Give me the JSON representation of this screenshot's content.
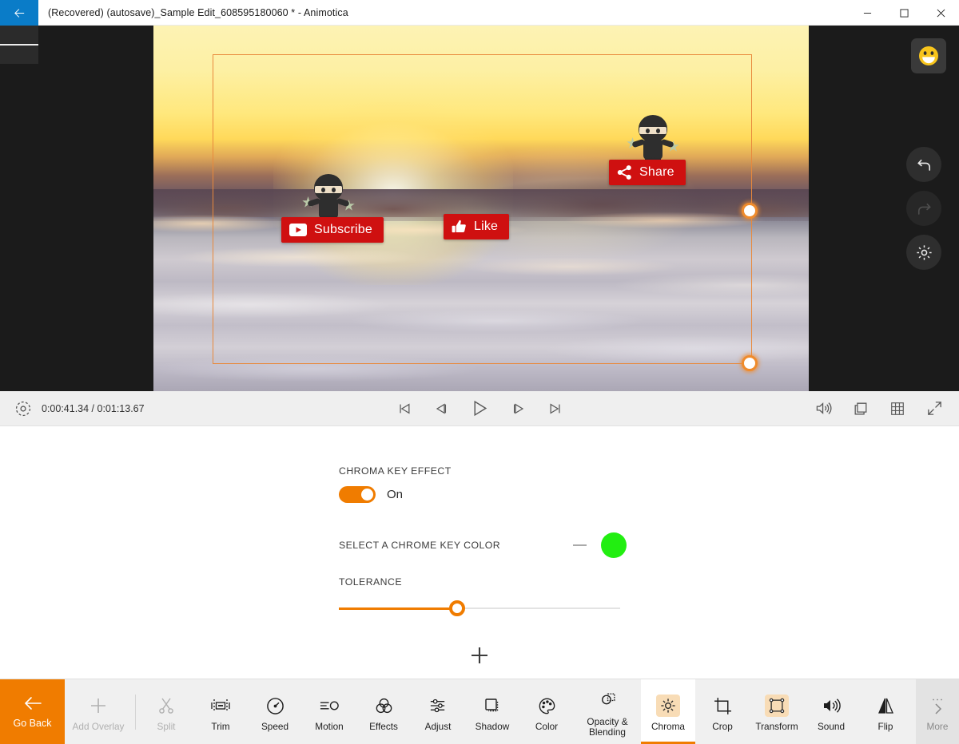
{
  "window": {
    "title": "(Recovered) (autosave)_Sample Edit_608595180060 * - Animotica",
    "back_icon": "arrow-left-icon",
    "minimize_label": "Minimize",
    "maximize_label": "Maximize",
    "close_label": "Close"
  },
  "stage": {
    "menu_icon": "hamburger-menu-icon",
    "right_rail": [
      {
        "name": "emoji-button",
        "icon": "smiley-face-icon",
        "state": "active"
      },
      {
        "name": "undo-button",
        "icon": "undo-arrow-icon",
        "state": "enabled"
      },
      {
        "name": "redo-button",
        "icon": "redo-arrow-icon",
        "state": "disabled"
      },
      {
        "name": "settings-button",
        "icon": "gear-icon",
        "state": "enabled"
      }
    ],
    "overlays": [
      {
        "label": "Subscribe",
        "icon": "youtube-play-icon",
        "color": "#cf1010"
      },
      {
        "label": "Like",
        "icon": "thumbs-up-icon",
        "color": "#cf1010"
      },
      {
        "label": "Share",
        "icon": "share-nodes-icon",
        "color": "#cf1010"
      }
    ],
    "selection_frame_color": "#e8893c"
  },
  "transport": {
    "settings_icon": "target-settings-icon",
    "timecode": "0:00:41.34 / 0:01:13.67",
    "current_time": "0:00:41.34",
    "total_time": "0:01:13.67",
    "controls": [
      {
        "name": "skip-to-start-button",
        "icon": "skip-start-icon"
      },
      {
        "name": "step-back-button",
        "icon": "step-back-icon"
      },
      {
        "name": "play-button",
        "icon": "play-icon"
      },
      {
        "name": "step-forward-button",
        "icon": "step-forward-icon"
      },
      {
        "name": "skip-to-end-button",
        "icon": "skip-end-icon"
      }
    ],
    "right_controls": [
      {
        "name": "volume-button",
        "icon": "speaker-volume-icon"
      },
      {
        "name": "duplicate-button",
        "icon": "copy-layers-icon"
      },
      {
        "name": "grid-button",
        "icon": "grid-icon"
      },
      {
        "name": "fullscreen-button",
        "icon": "expand-diagonal-icon"
      }
    ]
  },
  "panel": {
    "effect_label": "CHROMA KEY EFFECT",
    "toggle_state": "On",
    "toggle_on": true,
    "color_label": "SELECT A CHROME KEY COLOR",
    "selected_color": "#22ee11",
    "minus_icon": "minus-icon",
    "tolerance_label": "TOLERANCE",
    "tolerance_percent": 42,
    "add_icon": "plus-icon"
  },
  "toolbar": {
    "go_back": {
      "label": "Go Back",
      "icon": "arrow-left-icon"
    },
    "items": [
      {
        "label": "Add Overlay",
        "icon": "plus-icon",
        "disabled": true,
        "active": false,
        "icon_highlight": false
      },
      {
        "label": "Split",
        "icon": "scissors-icon",
        "disabled": true,
        "active": false,
        "icon_highlight": false
      },
      {
        "label": "Trim",
        "icon": "trim-icon",
        "disabled": false,
        "active": false,
        "icon_highlight": false
      },
      {
        "label": "Speed",
        "icon": "speedometer-icon",
        "disabled": false,
        "active": false,
        "icon_highlight": false
      },
      {
        "label": "Motion",
        "icon": "motion-icon",
        "disabled": false,
        "active": false,
        "icon_highlight": false
      },
      {
        "label": "Effects",
        "icon": "effects-rings-icon",
        "disabled": false,
        "active": false,
        "icon_highlight": false
      },
      {
        "label": "Adjust",
        "icon": "sliders-icon",
        "disabled": false,
        "active": false,
        "icon_highlight": false
      },
      {
        "label": "Shadow",
        "icon": "shadow-square-icon",
        "disabled": false,
        "active": false,
        "icon_highlight": false
      },
      {
        "label": "Color",
        "icon": "palette-icon",
        "disabled": false,
        "active": false,
        "icon_highlight": false
      },
      {
        "label": "Opacity & Blending",
        "icon": "opacity-layers-icon",
        "disabled": false,
        "active": false,
        "icon_highlight": false
      },
      {
        "label": "Chroma",
        "icon": "chroma-key-icon",
        "disabled": false,
        "active": true,
        "icon_highlight": true
      },
      {
        "label": "Crop",
        "icon": "crop-icon",
        "disabled": false,
        "active": false,
        "icon_highlight": false
      },
      {
        "label": "Transform",
        "icon": "transform-icon",
        "disabled": false,
        "active": false,
        "icon_highlight": true
      },
      {
        "label": "Sound",
        "icon": "speaker-volume-icon",
        "disabled": false,
        "active": false,
        "icon_highlight": false
      },
      {
        "label": "Flip",
        "icon": "flip-horizontal-icon",
        "disabled": false,
        "active": false,
        "icon_highlight": false
      }
    ],
    "more": {
      "label": "More",
      "icon": "chevron-right-icon"
    }
  },
  "colors": {
    "accent": "#f07c00",
    "titlebar_back": "#0a7cc8",
    "chroma_green": "#22ee11",
    "overlay_red": "#cf1010"
  }
}
